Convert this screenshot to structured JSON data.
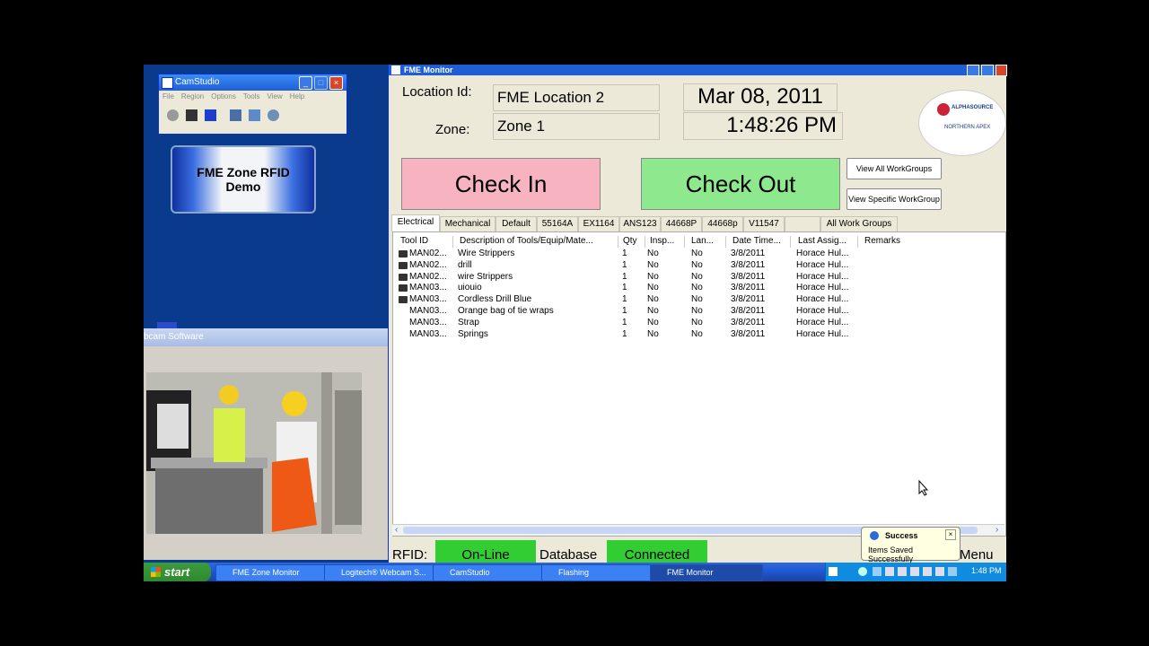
{
  "camstudio": {
    "title": "CamStudio",
    "menu": [
      "File",
      "Region",
      "Options",
      "Tools",
      "View",
      "Help"
    ]
  },
  "demo_button": "FME Zone RFID\nDemo",
  "webcam": {
    "title": "bcam Software"
  },
  "fme": {
    "title": "FME Monitor",
    "location_label": "Location Id:",
    "location_value": "FME Location 2",
    "zone_label": "Zone:",
    "zone_value": "Zone 1",
    "date": "Mar 08, 2011",
    "time": "1:48:26 PM",
    "check_in": "Check In",
    "check_out": "Check Out",
    "view_all_workgroups": "View All WorkGroups",
    "view_specific_workgroup": "View Specific WorkGroup",
    "logo_text": "ALPHASOURCE",
    "logo_sub": "NORTHERN APEX",
    "tabs": [
      "Electrical",
      "Mechanical",
      "Default",
      "55164A",
      "EX1164",
      "ANS123",
      "44668P",
      "44668p",
      "V11547",
      "",
      "All Work Groups"
    ],
    "columns": [
      "Tool ID",
      "Description of Tools/Equip/Mate...",
      "Qty",
      "Insp...",
      "Lan...",
      "Date Time...",
      "Last Assig...",
      "Remarks"
    ],
    "rows": [
      {
        "id": "MAN02...",
        "desc": "Wire Strippers",
        "qty": "1",
        "insp": "No",
        "lan": "No",
        "date": "3/8/2011",
        "last": "Horace Hul...",
        "remarks": "",
        "icon": true
      },
      {
        "id": "MAN02...",
        "desc": "drill",
        "qty": "1",
        "insp": "No",
        "lan": "No",
        "date": "3/8/2011",
        "last": "Horace Hul...",
        "remarks": "",
        "icon": true
      },
      {
        "id": "MAN02...",
        "desc": "wire Strippers",
        "qty": "1",
        "insp": "No",
        "lan": "No",
        "date": "3/8/2011",
        "last": "Horace Hul...",
        "remarks": "",
        "icon": true
      },
      {
        "id": "MAN03...",
        "desc": "uiouio",
        "qty": "1",
        "insp": "No",
        "lan": "No",
        "date": "3/8/2011",
        "last": "Horace Hul...",
        "remarks": "",
        "icon": true
      },
      {
        "id": "MAN03...",
        "desc": "Cordless Drill Blue",
        "qty": "1",
        "insp": "No",
        "lan": "No",
        "date": "3/8/2011",
        "last": "Horace Hul...",
        "remarks": "",
        "icon": true
      },
      {
        "id": "MAN03...",
        "desc": "Orange bag of tie wraps",
        "qty": "1",
        "insp": "No",
        "lan": "No",
        "date": "3/8/2011",
        "last": "Horace Hul...",
        "remarks": "",
        "icon": false
      },
      {
        "id": "MAN03...",
        "desc": "Strap",
        "qty": "1",
        "insp": "No",
        "lan": "No",
        "date": "3/8/2011",
        "last": "Horace Hul...",
        "remarks": "",
        "icon": false
      },
      {
        "id": "MAN03...",
        "desc": "Springs",
        "qty": "1",
        "insp": "No",
        "lan": "No",
        "date": "3/8/2011",
        "last": "Horace Hul...",
        "remarks": "",
        "icon": false
      }
    ],
    "status": {
      "rfid_label": "RFID:",
      "rfid_value": "On-Line",
      "db_label": "Database",
      "db_value": "Connected",
      "menu_label": "Menu"
    }
  },
  "balloon": {
    "title": "Success",
    "message": "Items Saved Successfully"
  },
  "taskbar": {
    "start": "start",
    "tasks": [
      "FME Zone Monitor",
      "Logitech® Webcam S...",
      "CamStudio",
      "Flashing",
      "FME Monitor"
    ],
    "clock": "1:48 PM"
  },
  "colors": {
    "check_in": "#f7b4c0",
    "check_out": "#8ee88e",
    "status_green": "#32cd32",
    "title_blue": "#1f5fd6"
  }
}
